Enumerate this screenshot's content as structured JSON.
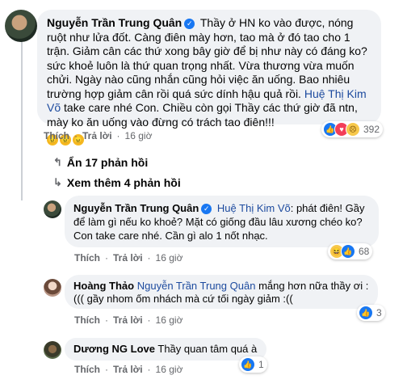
{
  "comment": {
    "author": "Nguyễn Trần Trung Quân",
    "text_main": "Thầy ở HN ko vào được, nóng ruột như lửa đốt. Càng điên mày hơn, tao mà ở đó tao cho 1 trận. Giảm cân các thứ xong bây giờ để bị như này có đáng ko? sức khoẻ luôn là thứ quan trọng nhất. Vừa thương vừa muốn chửi. Ngày nào cũng nhắn cũng hỏi việc ăn uống. Bao nhiêu trường hợp giảm cân rồi quá sức dính hậu quả rồi.",
    "mention": "Huệ Thị Kim Võ",
    "text_after": "take care nhé Con. Chiều còn gọi Thầy các thứ giờ đã ntn, mày ko ăn uống vào đừng có trách tao điên!!!",
    "emoji_row": [
      "😠",
      "😠",
      "😠"
    ],
    "like_label": "Thích",
    "reply_label": "Trả lời",
    "time": "16 giờ",
    "reaction_count": "392"
  },
  "hide_replies": "Ẩn 17 phản hồi",
  "see_more": "Xem thêm 4 phản hồi",
  "replies": [
    {
      "author": "Nguyễn Trần Trung Quân",
      "mention": "Huệ Thị Kim Võ",
      "text": ": phát điên! Gầy để làm gì nếu ko khoẻ? Mặt có giống đầu lâu xương chéo ko? Con take care nhé. Cần gì alo 1 nốt nhạc.",
      "like_label": "Thích",
      "reply_label": "Trả lời",
      "time": "16 giờ",
      "reaction_count": "68"
    },
    {
      "author": "Hoàng Thảo",
      "mention": "Nguyễn Trần Trung Quân",
      "text_line1": "mắng hơn nữa thầy ơi :",
      "text_line2": "((( gầy nhom ốm nhách mà cứ tối ngày giảm :((",
      "like_label": "Thích",
      "reply_label": "Trả lời",
      "time": "16 giờ",
      "reaction_count": "3"
    },
    {
      "author": "Dương NG Love",
      "text": "Thầy quan tâm quá à",
      "like_label": "Thích",
      "reply_label": "Trả lời",
      "time": "16 giờ",
      "reaction_count": "1"
    }
  ]
}
